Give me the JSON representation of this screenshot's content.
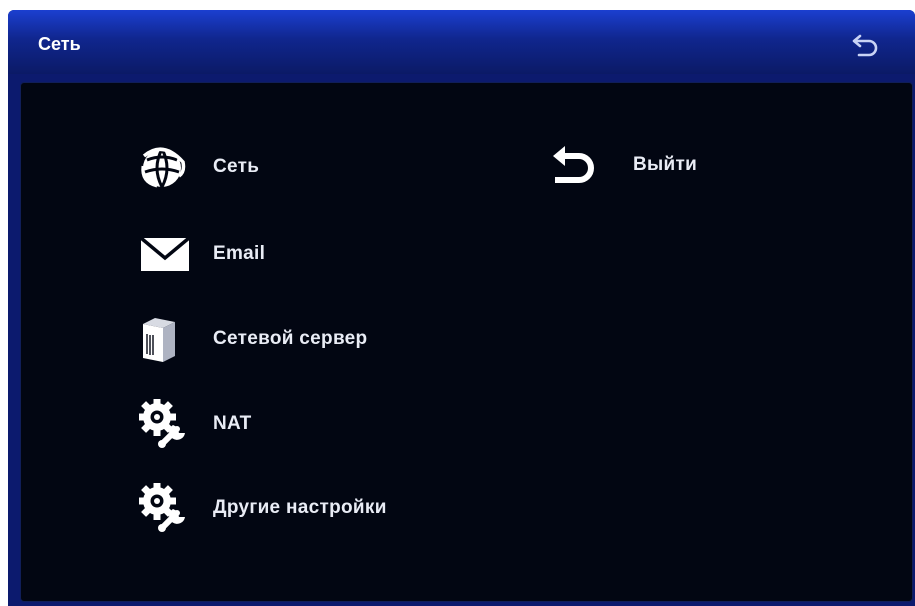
{
  "header": {
    "title": "Сеть",
    "back_icon": "back-arrow-icon"
  },
  "menu": {
    "items": [
      {
        "label": "Сеть",
        "icon": "globe-icon"
      },
      {
        "label": "Email",
        "icon": "envelope-icon"
      },
      {
        "label": "Сетевой сервер",
        "icon": "server-icon"
      },
      {
        "label": "NAT",
        "icon": "gear-wrench-icon"
      },
      {
        "label": "Другие настройки",
        "icon": "gear-wrench-icon"
      }
    ],
    "exit": {
      "label": "Выйти",
      "icon": "back-arrow-icon"
    }
  },
  "colors": {
    "title_bar": "#1b3fd0",
    "frame": "#0c1a6e",
    "panel": "#020612",
    "text": "#e9ecf5"
  }
}
